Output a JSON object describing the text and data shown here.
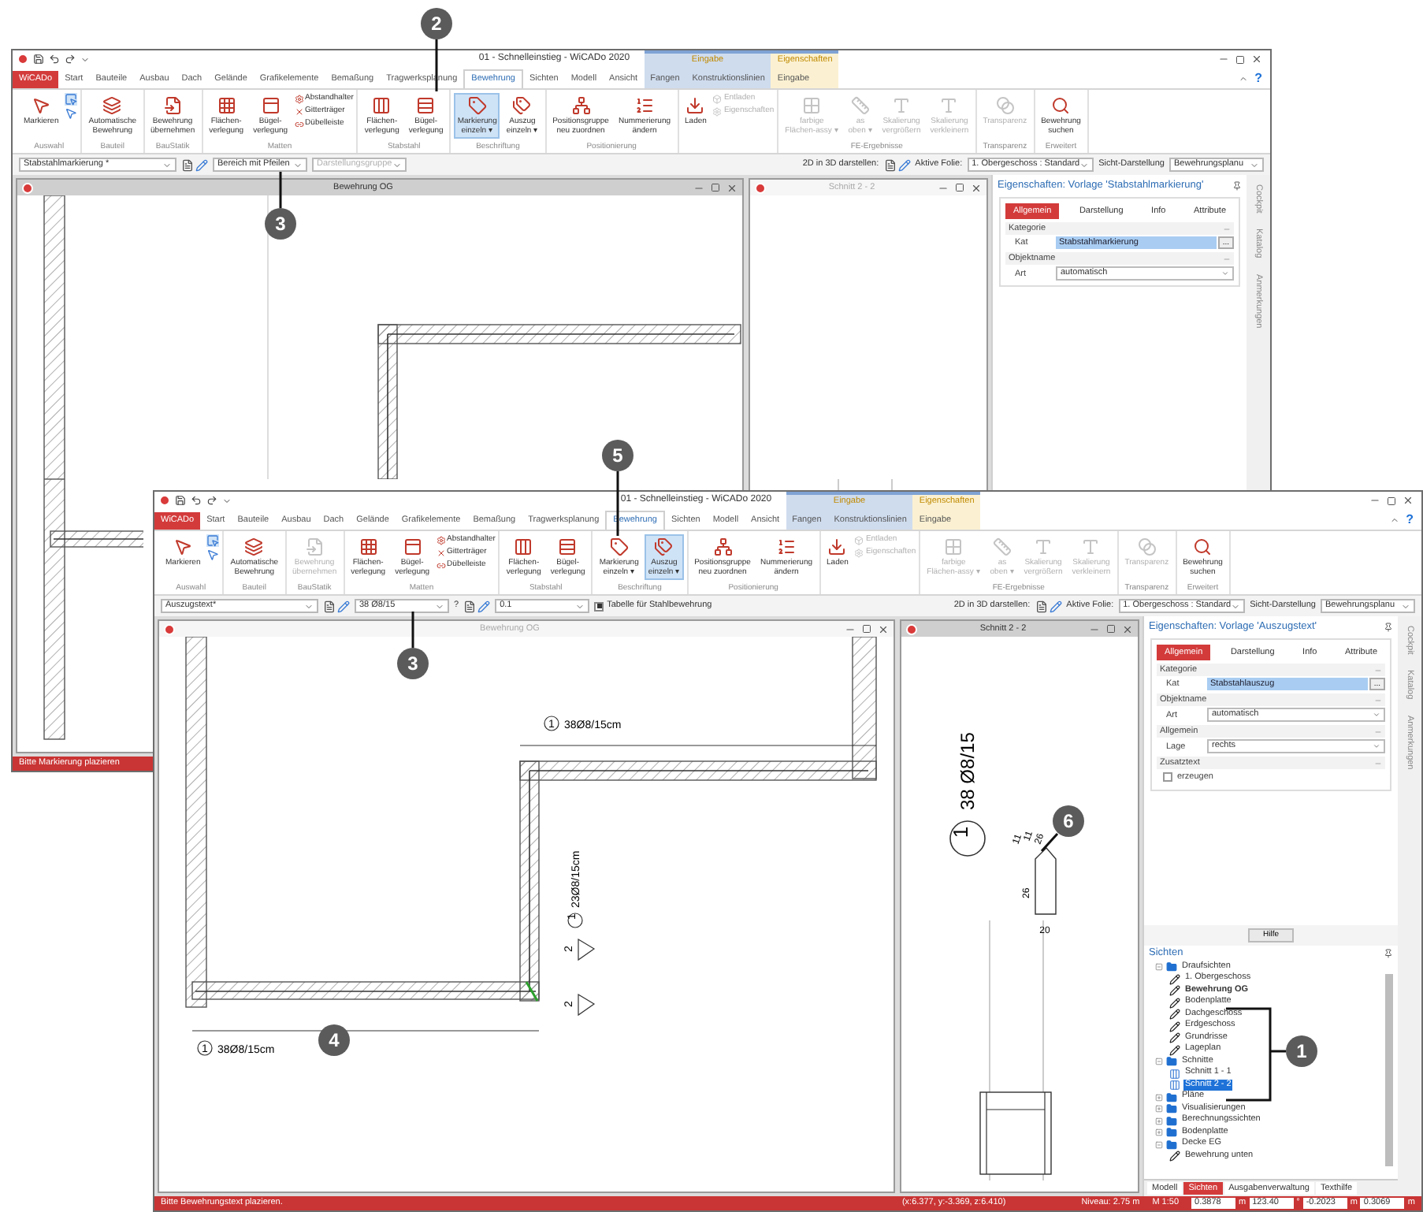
{
  "windows": [
    {
      "title": "01 - Schnelleinstieg - WiCADo 2020",
      "tabs": [
        {
          "label": "WiCADo",
          "kind": "app",
          "selected": false
        },
        {
          "label": "Start",
          "kind": "tab",
          "selected": false
        },
        {
          "label": "Bauteile",
          "kind": "tab",
          "selected": false
        },
        {
          "label": "Ausbau",
          "kind": "tab",
          "selected": false
        },
        {
          "label": "Dach",
          "kind": "tab",
          "selected": false
        },
        {
          "label": "Gelände",
          "kind": "tab",
          "selected": false
        },
        {
          "label": "Grafikelemente",
          "kind": "tab",
          "selected": false
        },
        {
          "label": "Bemaßung",
          "kind": "tab",
          "selected": false
        },
        {
          "label": "Tragwerksplanung",
          "kind": "tab",
          "selected": false
        },
        {
          "label": "Bewehrung",
          "kind": "tab",
          "selected": true
        },
        {
          "label": "Sichten",
          "kind": "tab",
          "selected": false
        },
        {
          "label": "Modell",
          "kind": "tab",
          "selected": false
        },
        {
          "label": "Ansicht",
          "kind": "tab",
          "selected": false
        }
      ],
      "context_groups": [
        {
          "header": "Eingabe",
          "color": "#cfdcee",
          "tabs": [
            "Fangen",
            "Konstruktionslinien"
          ]
        },
        {
          "header": "Eigenschaften",
          "color": "#fbf1d2",
          "tabs": [
            "Eingabe"
          ]
        }
      ],
      "help": "?",
      "ribbon": [
        {
          "label": "Auswahl",
          "items": [
            {
              "kind": "large",
              "label": "Markieren",
              "selected": false,
              "disabled": false
            },
            {
              "kind": "tools"
            }
          ]
        },
        {
          "label": "Bauteil",
          "items": [
            {
              "kind": "large",
              "label": "Automatische\nBewehrung",
              "selected": false,
              "disabled": false
            }
          ]
        },
        {
          "label": "BauStatik",
          "items": [
            {
              "kind": "large",
              "label": "Bewehrung\nübernehmen",
              "selected": false,
              "disabled": false
            }
          ]
        },
        {
          "label": "Matten",
          "items": [
            {
              "kind": "large",
              "label": "Flächen-\nverlegung",
              "selected": false,
              "disabled": false
            },
            {
              "kind": "large",
              "label": "Bügel-\nverlegung",
              "selected": false,
              "disabled": false
            },
            {
              "kind": "small",
              "label": "Abstandhalter",
              "disabled": false
            },
            {
              "kind": "small",
              "label": "Gitterträger",
              "disabled": false
            },
            {
              "kind": "small",
              "label": "Dübelleiste",
              "disabled": false
            }
          ]
        },
        {
          "label": "Stabstahl",
          "items": [
            {
              "kind": "large",
              "label": "Flächen-\nverlegung",
              "selected": false,
              "disabled": false
            },
            {
              "kind": "large",
              "label": "Bügel-\nverlegung",
              "selected": false,
              "disabled": false
            }
          ]
        },
        {
          "label": "Beschriftung",
          "items": [
            {
              "kind": "large",
              "label": "Markierung\neinzeln ▾",
              "selected": true,
              "disabled": false
            },
            {
              "kind": "large",
              "label": "Auszug\neinzeln ▾",
              "selected": false,
              "disabled": false
            }
          ]
        },
        {
          "label": "Positionierung",
          "items": [
            {
              "kind": "large",
              "label": "Positionsgruppe\nneu zuordnen",
              "selected": false,
              "disabled": false
            },
            {
              "kind": "large",
              "label": "Nummerierung\nändern",
              "selected": false,
              "disabled": false
            }
          ]
        },
        {
          "items": [
            {
              "kind": "large",
              "label": "Laden",
              "selected": false,
              "disabled": false
            },
            {
              "kind": "small",
              "label": "Entladen",
              "disabled": true
            },
            {
              "kind": "small",
              "label": "Eigenschaften",
              "disabled": true
            }
          ]
        },
        {
          "label": "FE-Ergebnisse",
          "items": [
            {
              "kind": "large",
              "label": "farbige\nFlächen-assy ▾",
              "selected": false,
              "disabled": true
            },
            {
              "kind": "large",
              "label": "as\noben ▾",
              "selected": false,
              "disabled": true
            },
            {
              "kind": "large",
              "label": "Skalierung\nvergrößern",
              "selected": false,
              "disabled": true
            },
            {
              "kind": "large",
              "label": "Skalierung\nverkleinern",
              "selected": false,
              "disabled": true
            }
          ]
        },
        {
          "label": "Transparenz",
          "items": [
            {
              "kind": "large",
              "label": "Transparenz",
              "selected": false,
              "disabled": true
            }
          ]
        },
        {
          "label": "Erweitert",
          "items": [
            {
              "kind": "large",
              "label": "Bewehrung\nsuchen",
              "selected": false,
              "disabled": false
            }
          ]
        }
      ],
      "toolbar": {
        "left": [
          {
            "kind": "select",
            "value": "Stabstahlmarkierung *",
            "disabled": false
          },
          {
            "kind": "tools"
          },
          {
            "kind": "select",
            "value": "Bereich mit Pfeilen",
            "disabled": false
          },
          {
            "kind": "select",
            "value": "Darstellungsgruppe",
            "disabled": true
          }
        ],
        "right": [
          {
            "kind": "text",
            "label": "2D in 3D darstellen:"
          },
          {
            "kind": "tools"
          },
          {
            "kind": "text",
            "label": "Aktive Folie:"
          },
          {
            "kind": "select",
            "value": "1. Obergeschoss : Standard",
            "disabled": false
          },
          {
            "kind": "text",
            "label": "Sicht-Darstellung"
          },
          {
            "kind": "select",
            "value": "Bewehrungsplanu",
            "disabled": false
          }
        ]
      },
      "views": [
        {
          "title": "Bewehrung OG",
          "kind": "plan",
          "active": true
        },
        {
          "title": "Schnitt 2 - 2",
          "kind": "section",
          "active": false
        }
      ],
      "panel": {
        "title": "Eigenschaften: Vorlage 'Stabstahlmarkierung'",
        "tabs": [
          {
            "label": "Allgemein",
            "selected": true
          },
          {
            "label": "Darstellung",
            "selected": false
          },
          {
            "label": "Info",
            "selected": false
          },
          {
            "label": "Attribute",
            "selected": false
          }
        ],
        "sections": [
          {
            "label": "Kategorie",
            "rows": [
              {
                "kind": "picker",
                "label": "Kat",
                "value": "Stabstahlmarkierung",
                "button": "..."
              }
            ]
          },
          {
            "label": "Objektname",
            "rows": [
              {
                "kind": "select",
                "label": "Art",
                "value": "automatisch"
              }
            ]
          }
        ]
      },
      "rail": [
        "Cockpit",
        "Katalog",
        "Anmerkungen"
      ],
      "status": {
        "message": "Bitte Markierung plazieren"
      }
    },
    {
      "title": "01 - Schnelleinstieg - WiCADo 2020",
      "tabs": [
        {
          "label": "WiCADo",
          "kind": "app",
          "selected": false
        },
        {
          "label": "Start",
          "kind": "tab",
          "selected": false
        },
        {
          "label": "Bauteile",
          "kind": "tab",
          "selected": false
        },
        {
          "label": "Ausbau",
          "kind": "tab",
          "selected": false
        },
        {
          "label": "Dach",
          "kind": "tab",
          "selected": false
        },
        {
          "label": "Gelände",
          "kind": "tab",
          "selected": false
        },
        {
          "label": "Grafikelemente",
          "kind": "tab",
          "selected": false
        },
        {
          "label": "Bemaßung",
          "kind": "tab",
          "selected": false
        },
        {
          "label": "Tragwerksplanung",
          "kind": "tab",
          "selected": false
        },
        {
          "label": "Bewehrung",
          "kind": "tab",
          "selected": true
        },
        {
          "label": "Sichten",
          "kind": "tab",
          "selected": false
        },
        {
          "label": "Modell",
          "kind": "tab",
          "selected": false
        },
        {
          "label": "Ansicht",
          "kind": "tab",
          "selected": false
        }
      ],
      "context_groups": [
        {
          "header": "Eingabe",
          "color": "#cfdcee",
          "tabs": [
            "Fangen",
            "Konstruktionslinien"
          ]
        },
        {
          "header": "Eigenschaften",
          "color": "#fbf1d2",
          "tabs": [
            "Eingabe"
          ]
        }
      ],
      "help": "?",
      "ribbon": [
        {
          "label": "Auswahl",
          "items": [
            {
              "kind": "large",
              "label": "Markieren",
              "selected": false,
              "disabled": false
            },
            {
              "kind": "tools"
            }
          ]
        },
        {
          "label": "Bauteil",
          "items": [
            {
              "kind": "large",
              "label": "Automatische\nBewehrung",
              "selected": false,
              "disabled": false
            }
          ]
        },
        {
          "label": "BauStatik",
          "items": [
            {
              "kind": "large",
              "label": "Bewehrung\nübernehmen",
              "selected": false,
              "disabled": true
            }
          ]
        },
        {
          "label": "Matten",
          "items": [
            {
              "kind": "large",
              "label": "Flächen-\nverlegung",
              "selected": false,
              "disabled": false
            },
            {
              "kind": "large",
              "label": "Bügel-\nverlegung",
              "selected": false,
              "disabled": false
            },
            {
              "kind": "small",
              "label": "Abstandhalter",
              "disabled": false
            },
            {
              "kind": "small",
              "label": "Gitterträger",
              "disabled": false
            },
            {
              "kind": "small",
              "label": "Dübelleiste",
              "disabled": false
            }
          ]
        },
        {
          "label": "Stabstahl",
          "items": [
            {
              "kind": "large",
              "label": "Flächen-\nverlegung",
              "selected": false,
              "disabled": false
            },
            {
              "kind": "large",
              "label": "Bügel-\nverlegung",
              "selected": false,
              "disabled": false
            }
          ]
        },
        {
          "label": "Beschriftung",
          "items": [
            {
              "kind": "large",
              "label": "Markierung\neinzeln ▾",
              "selected": false,
              "disabled": false
            },
            {
              "kind": "large",
              "label": "Auszug\neinzeln ▾",
              "selected": true,
              "disabled": false
            }
          ]
        },
        {
          "label": "Positionierung",
          "items": [
            {
              "kind": "large",
              "label": "Positionsgruppe\nneu zuordnen",
              "selected": false,
              "disabled": false
            },
            {
              "kind": "large",
              "label": "Nummerierung\nändern",
              "selected": false,
              "disabled": false
            }
          ]
        },
        {
          "items": [
            {
              "kind": "large",
              "label": "Laden",
              "selected": false,
              "disabled": false
            },
            {
              "kind": "small",
              "label": "Entladen",
              "disabled": true
            },
            {
              "kind": "small",
              "label": "Eigenschaften",
              "disabled": true
            }
          ]
        },
        {
          "label": "FE-Ergebnisse",
          "items": [
            {
              "kind": "large",
              "label": "farbige\nFlächen-assy ▾",
              "selected": false,
              "disabled": true
            },
            {
              "kind": "large",
              "label": "as\noben ▾",
              "selected": false,
              "disabled": true
            },
            {
              "kind": "large",
              "label": "Skalierung\nvergrößern",
              "selected": false,
              "disabled": true
            },
            {
              "kind": "large",
              "label": "Skalierung\nverkleinern",
              "selected": false,
              "disabled": true
            }
          ]
        },
        {
          "label": "Transparenz",
          "items": [
            {
              "kind": "large",
              "label": "Transparenz",
              "selected": false,
              "disabled": true
            }
          ]
        },
        {
          "label": "Erweitert",
          "items": [
            {
              "kind": "large",
              "label": "Bewehrung\nsuchen",
              "selected": false,
              "disabled": false
            }
          ]
        }
      ],
      "toolbar": {
        "left": [
          {
            "kind": "select",
            "value": "Auszugstext*",
            "disabled": false
          },
          {
            "kind": "tools"
          },
          {
            "kind": "select",
            "value": "38 Ø8/15",
            "disabled": false
          },
          {
            "kind": "text",
            "label": "?"
          },
          {
            "kind": "tools"
          },
          {
            "kind": "select",
            "value": "0.1",
            "disabled": false
          },
          {
            "kind": "checkbox",
            "label": "Tabelle für Stahlbewehrung",
            "checked": true
          }
        ],
        "right": [
          {
            "kind": "text",
            "label": "2D in 3D darstellen:"
          },
          {
            "kind": "tools"
          },
          {
            "kind": "text",
            "label": "Aktive Folie:"
          },
          {
            "kind": "select",
            "value": "1. Obergeschoss : Standard",
            "disabled": false
          },
          {
            "kind": "text",
            "label": "Sicht-Darstellung"
          },
          {
            "kind": "select",
            "value": "Bewehrungsplanu",
            "disabled": false
          }
        ]
      },
      "views": [
        {
          "title": "Bewehrung OG",
          "kind": "plan",
          "active": false,
          "labels": [
            "1",
            "38Ø8/15cm",
            "1",
            "23Ø8/15cm",
            "2",
            "2",
            "1",
            "38Ø8/15cm"
          ]
        },
        {
          "title": "Schnitt 2 - 2",
          "kind": "section",
          "active": true,
          "labels": [
            "1",
            "38 Ø8/15",
            "11",
            "11",
            "26",
            "26",
            "20"
          ]
        }
      ],
      "panel": {
        "title": "Eigenschaften: Vorlage 'Auszugstext'",
        "tabs": [
          {
            "label": "Allgemein",
            "selected": true
          },
          {
            "label": "Darstellung",
            "selected": false
          },
          {
            "label": "Info",
            "selected": false
          },
          {
            "label": "Attribute",
            "selected": false
          }
        ],
        "sections": [
          {
            "label": "Kategorie",
            "rows": [
              {
                "kind": "picker",
                "label": "Kat",
                "value": "Stabstahlauszug",
                "button": "..."
              }
            ]
          },
          {
            "label": "Objektname",
            "rows": [
              {
                "kind": "select",
                "label": "Art",
                "value": "automatisch"
              }
            ]
          },
          {
            "label": "Allgemein",
            "rows": [
              {
                "kind": "select",
                "label": "Lage",
                "value": "rechts"
              }
            ]
          },
          {
            "label": "Zusatztext",
            "rows": [
              {
                "kind": "checkbox",
                "label": "erzeugen",
                "checked": false
              }
            ]
          }
        ],
        "help_button": "Hilfe",
        "tree": {
          "title": "Sichten",
          "nodes": [
            {
              "label": "Draufsichten",
              "kind": "folder",
              "expanded": true,
              "selected": false,
              "current": false,
              "children": [
                {
                  "label": "1. Obergeschoss",
                  "kind": "plan",
                  "selected": false,
                  "current": false
                },
                {
                  "label": "Bewehrung OG",
                  "kind": "plan",
                  "selected": false,
                  "current": true
                },
                {
                  "label": "Bodenplatte",
                  "kind": "plan",
                  "selected": false,
                  "current": false
                },
                {
                  "label": "Dachgeschoss",
                  "kind": "plan",
                  "selected": false,
                  "current": false
                },
                {
                  "label": "Erdgeschoss",
                  "kind": "plan",
                  "selected": false,
                  "current": false
                },
                {
                  "label": "Grundrisse",
                  "kind": "plan",
                  "selected": false,
                  "current": false
                },
                {
                  "label": "Lageplan",
                  "kind": "plan",
                  "selected": false,
                  "current": false
                }
              ]
            },
            {
              "label": "Schnitte",
              "kind": "folder",
              "expanded": true,
              "selected": false,
              "current": false,
              "children": [
                {
                  "label": "Schnitt 1 - 1",
                  "kind": "section",
                  "selected": false,
                  "current": false
                },
                {
                  "label": "Schnitt 2 - 2",
                  "kind": "section",
                  "selected": true,
                  "current": false
                }
              ]
            },
            {
              "label": "Pläne",
              "kind": "folder",
              "expanded": false,
              "selected": false,
              "current": false
            },
            {
              "label": "Visualisierungen",
              "kind": "folder",
              "expanded": false,
              "selected": false,
              "current": false
            },
            {
              "label": "Berechnungssichten",
              "kind": "folder",
              "expanded": false,
              "selected": false,
              "current": false
            },
            {
              "label": "Bodenplatte",
              "kind": "folder",
              "expanded": false,
              "selected": false,
              "current": false
            },
            {
              "label": "Decke EG",
              "kind": "folder",
              "expanded": true,
              "selected": false,
              "current": false,
              "children": [
                {
                  "label": "Bewehrung unten",
                  "kind": "plan",
                  "selected": false,
                  "current": false
                }
              ]
            }
          ]
        },
        "bottom_tabs": [
          {
            "label": "Modell",
            "selected": false
          },
          {
            "label": "Sichten",
            "selected": true
          },
          {
            "label": "Ausgabenverwaltung",
            "selected": false
          },
          {
            "label": "Texthilfe",
            "selected": false
          }
        ]
      },
      "rail": [
        "Cockpit",
        "Katalog",
        "Anmerkungen"
      ],
      "status": {
        "message": "Bitte Bewehrungstext plazieren.",
        "coords": "(x:6.377, y:-3.369, z:6.410)",
        "level": "Niveau: 2.75 m",
        "scale": "M 1:50",
        "fields": [
          {
            "value": "0.3878",
            "unit": "m"
          },
          {
            "value": "123.40",
            "unit": "°"
          },
          {
            "value": "-0.2023",
            "unit": "m"
          },
          {
            "value": "0.3069",
            "unit": "m"
          }
        ]
      }
    }
  ],
  "callouts": [
    "2",
    "3",
    "5",
    "3",
    "6",
    "1",
    "4"
  ]
}
